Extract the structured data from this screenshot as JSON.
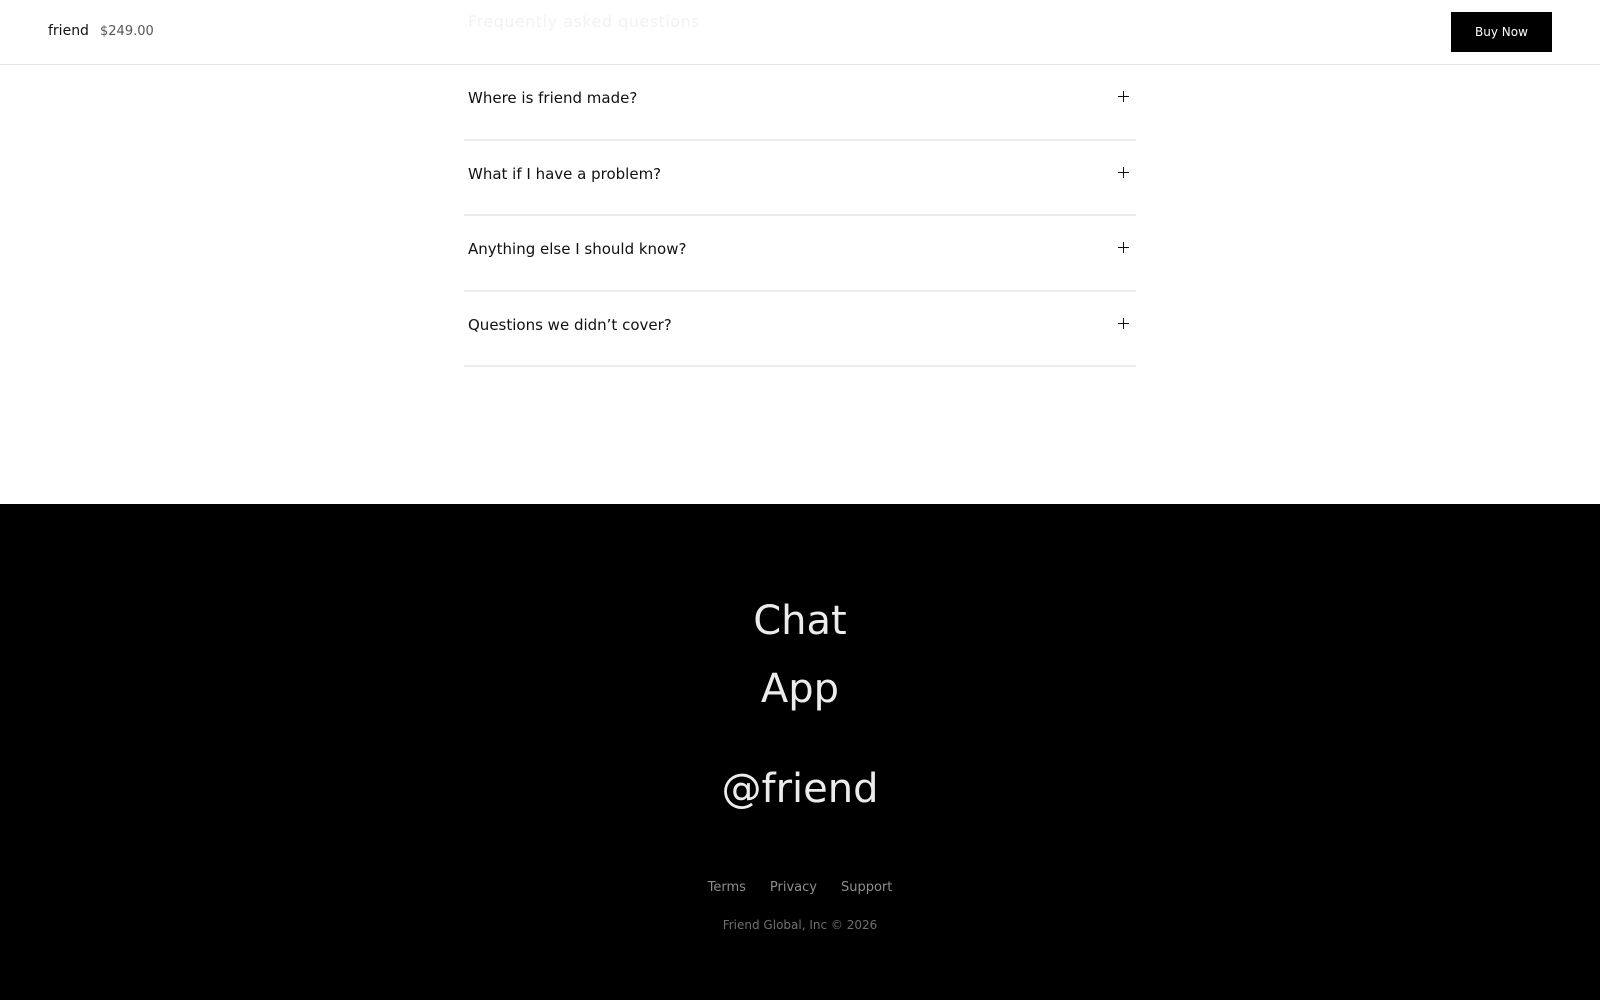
{
  "header": {
    "brand": "friend",
    "price": "$249.00",
    "buy_label": "Buy Now"
  },
  "faq": {
    "ghost_heading": "Frequently asked questions",
    "items": [
      {
        "question": "Where is friend made?"
      },
      {
        "question": "What if I have a problem?"
      },
      {
        "question": "Anything else I should know?"
      },
      {
        "question": "Questions we didn’t cover?"
      }
    ]
  },
  "footer": {
    "chat_label": "Chat",
    "app_label": "App",
    "handle": "@friend",
    "links": [
      "Terms",
      "Privacy",
      "Support"
    ],
    "copyright": "Friend Global, Inc © 2026"
  },
  "colors": {
    "accent": "#000000",
    "footer_bg": "#000000",
    "divider": "#ececec"
  },
  "icons": {
    "expand": "plus-icon"
  }
}
